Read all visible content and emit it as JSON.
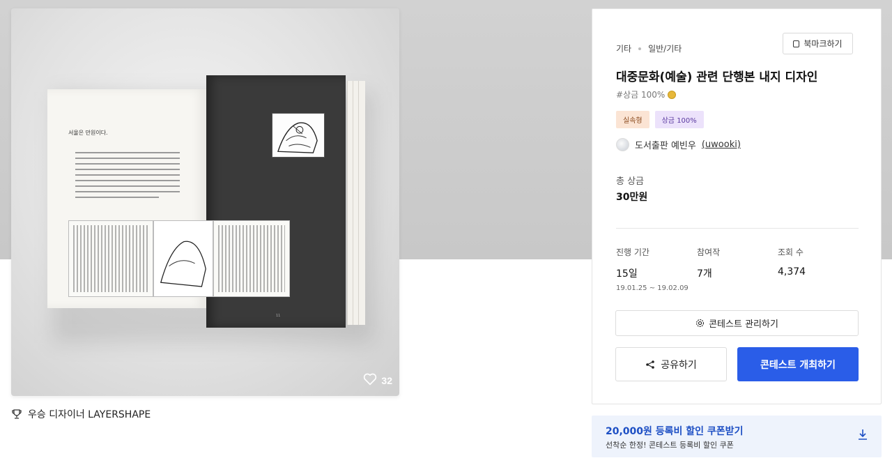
{
  "gallery": {
    "likes": "32",
    "book": {
      "left_heading": "서울은 만원이다."
    }
  },
  "designer": {
    "award_label": "우승 디자이너 LAYERSHAPE"
  },
  "contest": {
    "breadcrumb": [
      "기타",
      "일반/기타"
    ],
    "bookmark_label": "북마크하기",
    "title": "대중문화(예술) 관련 단행본 내지 디자인",
    "hashtag": "#상금 100%",
    "tags": [
      "실속형",
      "상금 100%"
    ],
    "owner_name": "도서출판 예빈우",
    "owner_handle": "(uwooki)",
    "prize_label": "총 상금",
    "prize_value": "30만원",
    "stats": {
      "period_label": "진행 기간",
      "period_value": "15일",
      "period_range": "19.01.25 ~ 19.02.09",
      "entries_label": "참여작",
      "entries_value": "7개",
      "views_label": "조회 수",
      "views_value": "4,374"
    },
    "manage_label": "콘테스트 관리하기",
    "share_label": "공유하기",
    "host_label": "콘테스트 개최하기"
  },
  "coupon": {
    "title": "20,000원 등록비 할인 쿠폰받기",
    "subtitle": "선착순 한정! 콘테스트 등록비 할인 쿠폰"
  },
  "colors": {
    "primary": "#2a5de8",
    "coupon_bg": "#eef3fc",
    "coupon_text": "#1d4fc4",
    "tag_orange_bg": "#fbe4d4",
    "tag_purple_bg": "#ece2fb"
  }
}
